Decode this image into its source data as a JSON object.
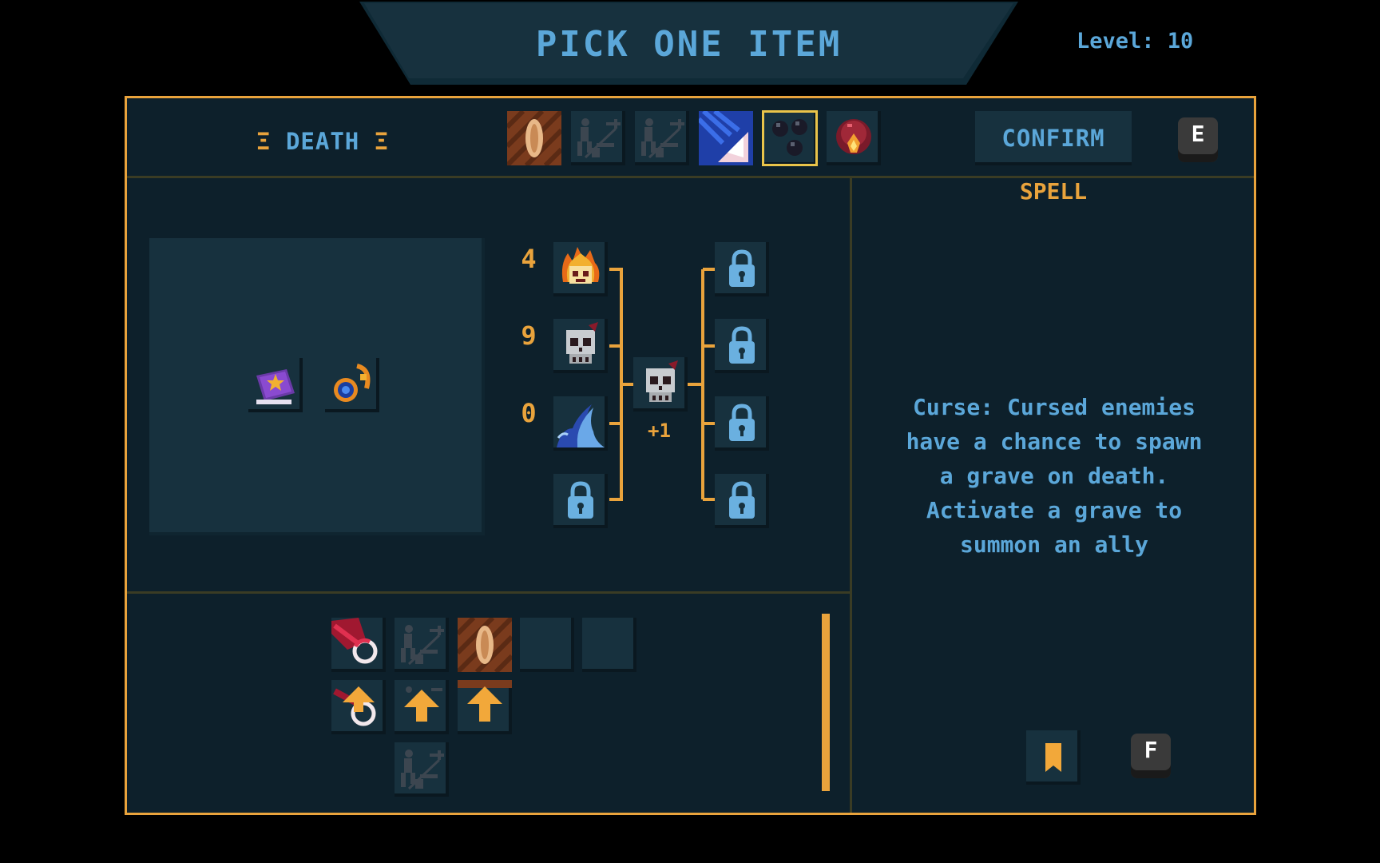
{
  "header": {
    "title": "PICK ONE ITEM",
    "level": "Level: 10"
  },
  "category": {
    "left_mark": "Ξ",
    "label": "DEATH",
    "right_mark": "Ξ"
  },
  "tabs": [
    {
      "icon": "seed-icon"
    },
    {
      "icon": "dash-locked-icon"
    },
    {
      "icon": "dash-locked-icon"
    },
    {
      "icon": "claw-icon"
    },
    {
      "icon": "bombs-icon",
      "selected": true
    },
    {
      "icon": "fire-orb-icon"
    }
  ],
  "confirm_label": "CONFIRM",
  "confirm_key": "E",
  "preview_items": [
    {
      "icon": "spellbook-icon"
    },
    {
      "icon": "amulet-icon"
    }
  ],
  "tree": {
    "inputs": [
      {
        "count": "4",
        "icon": "flame-skull-icon"
      },
      {
        "count": "9",
        "icon": "skull-icon"
      },
      {
        "count": "0",
        "icon": "wave-icon"
      },
      {
        "count": "",
        "icon": "lock-icon"
      }
    ],
    "center": {
      "icon": "skull-icon",
      "bonus": "+1"
    },
    "outputs": [
      {
        "icon": "lock-icon"
      },
      {
        "icon": "lock-icon"
      },
      {
        "icon": "lock-icon"
      },
      {
        "icon": "lock-icon"
      }
    ]
  },
  "details": {
    "type": "SPELL",
    "lines": [
      "Curse: Cursed enemies",
      "have a chance to spawn",
      "a grave on death.",
      "Activate a grave to",
      "summon an ally"
    ]
  },
  "inventory": [
    {
      "icon": "red-ring-icon"
    },
    {
      "icon": "dash-locked-icon"
    },
    {
      "icon": "seed-icon"
    },
    {
      "icon": "empty-slot"
    },
    {
      "icon": "empty-slot"
    },
    {
      "icon": "ring-arrow-icon"
    },
    {
      "icon": "arrow-up-icon"
    },
    {
      "icon": "arrow-up-icon"
    },
    {
      "icon": "dash-locked-icon"
    }
  ],
  "bookmark_key": "F",
  "colors": {
    "accent": "#e9a33c",
    "text": "#5ba7d9",
    "panel": "#0d202b",
    "slot": "#17313e"
  }
}
